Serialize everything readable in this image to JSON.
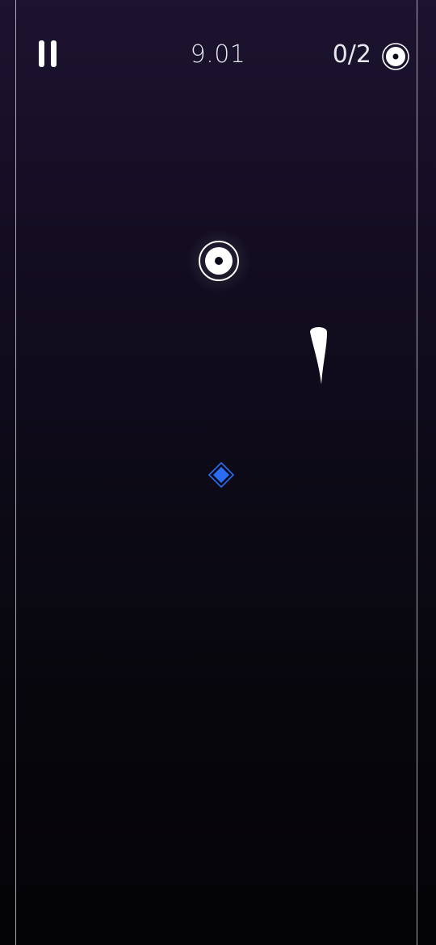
{
  "hud": {
    "timer": "9.01",
    "collected": "0/2",
    "collected_count": 0,
    "collected_total": 2,
    "pause_icon": "pause-icon",
    "collectible_icon": "target-ring-icon"
  },
  "objects": {
    "target": "target-ring-icon",
    "player": "comet-icon",
    "gem": "diamond-icon"
  },
  "colors": {
    "background_top": "#1d1330",
    "background_bottom": "#040306",
    "foreground": "#ffffff",
    "gem_blue": "#2a6df4"
  }
}
